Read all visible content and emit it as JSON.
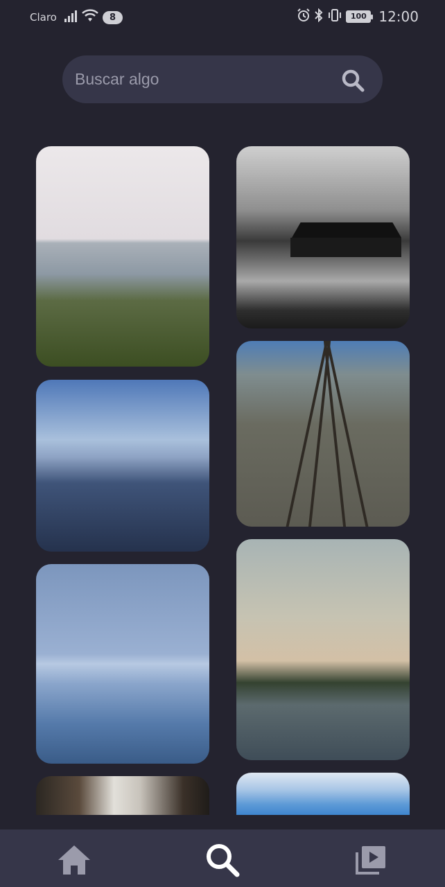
{
  "status_bar": {
    "carrier": "Claro",
    "notification_count": "8",
    "battery": "100",
    "time": "12:00"
  },
  "search": {
    "placeholder": "Buscar algo",
    "icon": "search-icon"
  },
  "gallery": {
    "images": [
      {
        "description_icon": "image",
        "column": "left"
      },
      {
        "description_icon": "image",
        "column": "right"
      },
      {
        "description_icon": "image",
        "column": "left"
      },
      {
        "description_icon": "image",
        "column": "right"
      },
      {
        "description_icon": "image",
        "column": "left"
      },
      {
        "description_icon": "image",
        "column": "right"
      },
      {
        "description_icon": "image",
        "column": "left"
      },
      {
        "description_icon": "image",
        "column": "right"
      }
    ]
  },
  "bottom_nav": {
    "items": [
      {
        "icon": "home-icon",
        "active": false
      },
      {
        "icon": "search-icon",
        "active": true
      },
      {
        "icon": "video-library-icon",
        "active": false
      }
    ]
  },
  "colors": {
    "background": "#24232f",
    "surface": "#363649",
    "icon_inactive": "#9b9bab",
    "icon_active": "#ffffff"
  }
}
